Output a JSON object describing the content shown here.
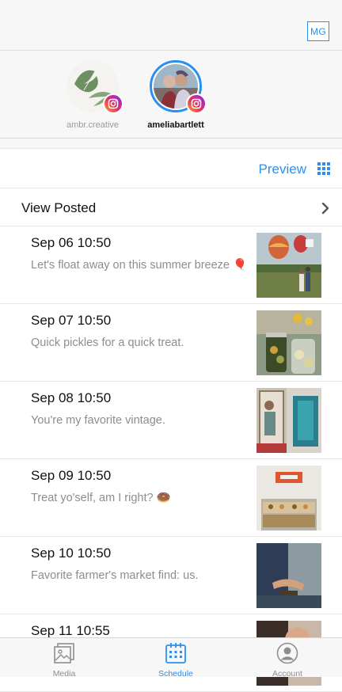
{
  "header": {
    "user_initials": "MG"
  },
  "accounts": [
    {
      "name": "ambr.creative",
      "selected": false
    },
    {
      "name": "ameliabartlett",
      "selected": true
    }
  ],
  "toolbar": {
    "preview_label": "Preview"
  },
  "view_posted": {
    "label": "View Posted"
  },
  "posts": [
    {
      "date": "Sep 06 10:50",
      "caption": "Let's float away on this summer breeze 🎈"
    },
    {
      "date": "Sep 07 10:50",
      "caption": "Quick pickles for a quick treat."
    },
    {
      "date": "Sep 08 10:50",
      "caption": "You're my favorite vintage."
    },
    {
      "date": "Sep 09 10:50",
      "caption": "Treat yo'self, am I right? 🍩"
    },
    {
      "date": "Sep 10 10:50",
      "caption": "Favorite farmer's market find: us."
    },
    {
      "date": "Sep 11 10:55",
      "caption": ""
    }
  ],
  "tabs": [
    {
      "label": "Media",
      "icon": "media-icon"
    },
    {
      "label": "Schedule",
      "icon": "calendar-icon"
    },
    {
      "label": "Account",
      "icon": "account-icon"
    }
  ],
  "colors": {
    "accent": "#2b8ff0",
    "background": "#f7f7f7",
    "muted_text": "#8d8d8d"
  }
}
